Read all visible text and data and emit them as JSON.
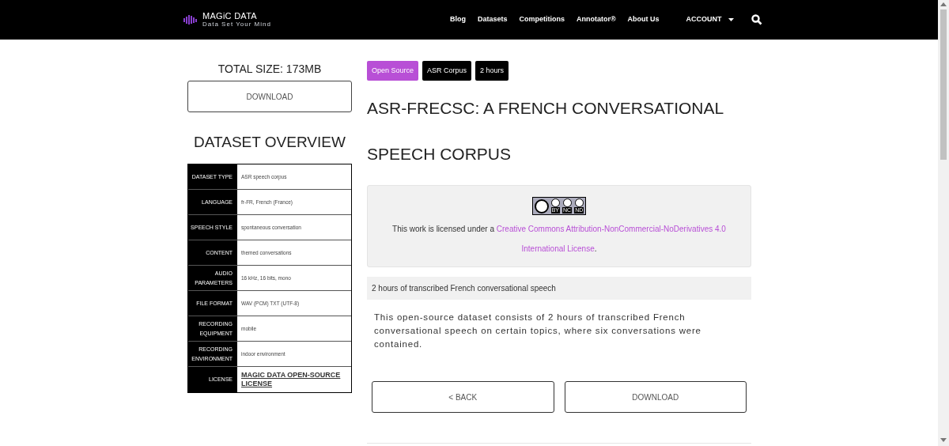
{
  "header": {
    "logo": {
      "name": "MAGiC DATA",
      "tagline": "Data Set Your Mind"
    },
    "nav": [
      {
        "label": "Blog"
      },
      {
        "label": "Datasets"
      },
      {
        "label": "Competitions"
      },
      {
        "label": "Annotator®"
      },
      {
        "label": "About Us"
      }
    ],
    "account": "ACCOUNT"
  },
  "sidebar": {
    "total_size": "TOTAL SIZE: 173MB",
    "download": "DOWNLOAD",
    "overview_title": "DATASET OVERVIEW",
    "rows": [
      {
        "label": "DATASET TYPE",
        "value": "ASR speech corpus",
        "kind": "text"
      },
      {
        "label": "LANGUAGE",
        "value": "fr-FR, French (France)",
        "kind": "text"
      },
      {
        "label": "SPEECH STYLE",
        "value": "spontaneous conversation",
        "kind": "text"
      },
      {
        "label": "CONTENT",
        "value": "themed conversations",
        "kind": "text"
      },
      {
        "label": "AUDIO PARAMETERS",
        "value": "16 kHz, 16 bits, mono",
        "kind": "text"
      },
      {
        "label": "FILE FORMAT",
        "value": "WAV (PCM) TXT (UTF-8)",
        "kind": "text"
      },
      {
        "label": "RECORDING EQUIPMENT",
        "value": "mobile",
        "kind": "text"
      },
      {
        "label": "RECORDING ENVIRONMENT",
        "value": "indoor environment",
        "kind": "text"
      },
      {
        "label": "LICENSE",
        "value": "MAGIC DATA OPEN-SOURCE LICENSE",
        "kind": "link"
      }
    ]
  },
  "main": {
    "tags": [
      {
        "label": "Open Source",
        "color": "#b84fd6"
      },
      {
        "label": "ASR Corpus",
        "color": "#000000"
      },
      {
        "label": "2 hours",
        "color": "#000000"
      }
    ],
    "title": "ASR-FRECSC: A FRENCH CONVERSATIONAL SPEECH CORPUS",
    "license_box": {
      "badge_labels": [
        "BY",
        "NC",
        "ND"
      ],
      "text": "This work is licensed under a ",
      "link_lines": [
        "Creative Commons Attribution-NonCommercial-NoDerivatives 4.0",
        "International License"
      ],
      "end": "."
    },
    "summary": "2 hours of transcribed French conversational speech",
    "description": "This open-source dataset consists of 2 hours of transcribed French conversational speech on certain topics, where six conversations were contained.",
    "buttons": [
      "< BACK",
      "DOWNLOAD"
    ]
  }
}
